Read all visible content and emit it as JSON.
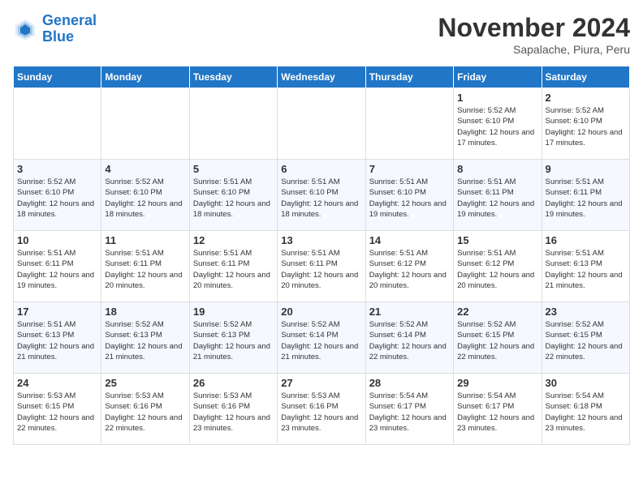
{
  "logo": {
    "line1": "General",
    "line2": "Blue"
  },
  "title": "November 2024",
  "subtitle": "Sapalache, Piura, Peru",
  "days_of_week": [
    "Sunday",
    "Monday",
    "Tuesday",
    "Wednesday",
    "Thursday",
    "Friday",
    "Saturday"
  ],
  "weeks": [
    [
      {
        "day": "",
        "info": ""
      },
      {
        "day": "",
        "info": ""
      },
      {
        "day": "",
        "info": ""
      },
      {
        "day": "",
        "info": ""
      },
      {
        "day": "",
        "info": ""
      },
      {
        "day": "1",
        "info": "Sunrise: 5:52 AM\nSunset: 6:10 PM\nDaylight: 12 hours and 17 minutes."
      },
      {
        "day": "2",
        "info": "Sunrise: 5:52 AM\nSunset: 6:10 PM\nDaylight: 12 hours and 17 minutes."
      }
    ],
    [
      {
        "day": "3",
        "info": "Sunrise: 5:52 AM\nSunset: 6:10 PM\nDaylight: 12 hours and 18 minutes."
      },
      {
        "day": "4",
        "info": "Sunrise: 5:52 AM\nSunset: 6:10 PM\nDaylight: 12 hours and 18 minutes."
      },
      {
        "day": "5",
        "info": "Sunrise: 5:51 AM\nSunset: 6:10 PM\nDaylight: 12 hours and 18 minutes."
      },
      {
        "day": "6",
        "info": "Sunrise: 5:51 AM\nSunset: 6:10 PM\nDaylight: 12 hours and 18 minutes."
      },
      {
        "day": "7",
        "info": "Sunrise: 5:51 AM\nSunset: 6:10 PM\nDaylight: 12 hours and 19 minutes."
      },
      {
        "day": "8",
        "info": "Sunrise: 5:51 AM\nSunset: 6:11 PM\nDaylight: 12 hours and 19 minutes."
      },
      {
        "day": "9",
        "info": "Sunrise: 5:51 AM\nSunset: 6:11 PM\nDaylight: 12 hours and 19 minutes."
      }
    ],
    [
      {
        "day": "10",
        "info": "Sunrise: 5:51 AM\nSunset: 6:11 PM\nDaylight: 12 hours and 19 minutes."
      },
      {
        "day": "11",
        "info": "Sunrise: 5:51 AM\nSunset: 6:11 PM\nDaylight: 12 hours and 20 minutes."
      },
      {
        "day": "12",
        "info": "Sunrise: 5:51 AM\nSunset: 6:11 PM\nDaylight: 12 hours and 20 minutes."
      },
      {
        "day": "13",
        "info": "Sunrise: 5:51 AM\nSunset: 6:11 PM\nDaylight: 12 hours and 20 minutes."
      },
      {
        "day": "14",
        "info": "Sunrise: 5:51 AM\nSunset: 6:12 PM\nDaylight: 12 hours and 20 minutes."
      },
      {
        "day": "15",
        "info": "Sunrise: 5:51 AM\nSunset: 6:12 PM\nDaylight: 12 hours and 20 minutes."
      },
      {
        "day": "16",
        "info": "Sunrise: 5:51 AM\nSunset: 6:13 PM\nDaylight: 12 hours and 21 minutes."
      }
    ],
    [
      {
        "day": "17",
        "info": "Sunrise: 5:51 AM\nSunset: 6:13 PM\nDaylight: 12 hours and 21 minutes."
      },
      {
        "day": "18",
        "info": "Sunrise: 5:52 AM\nSunset: 6:13 PM\nDaylight: 12 hours and 21 minutes."
      },
      {
        "day": "19",
        "info": "Sunrise: 5:52 AM\nSunset: 6:13 PM\nDaylight: 12 hours and 21 minutes."
      },
      {
        "day": "20",
        "info": "Sunrise: 5:52 AM\nSunset: 6:14 PM\nDaylight: 12 hours and 21 minutes."
      },
      {
        "day": "21",
        "info": "Sunrise: 5:52 AM\nSunset: 6:14 PM\nDaylight: 12 hours and 22 minutes."
      },
      {
        "day": "22",
        "info": "Sunrise: 5:52 AM\nSunset: 6:15 PM\nDaylight: 12 hours and 22 minutes."
      },
      {
        "day": "23",
        "info": "Sunrise: 5:52 AM\nSunset: 6:15 PM\nDaylight: 12 hours and 22 minutes."
      }
    ],
    [
      {
        "day": "24",
        "info": "Sunrise: 5:53 AM\nSunset: 6:15 PM\nDaylight: 12 hours and 22 minutes."
      },
      {
        "day": "25",
        "info": "Sunrise: 5:53 AM\nSunset: 6:16 PM\nDaylight: 12 hours and 22 minutes."
      },
      {
        "day": "26",
        "info": "Sunrise: 5:53 AM\nSunset: 6:16 PM\nDaylight: 12 hours and 23 minutes."
      },
      {
        "day": "27",
        "info": "Sunrise: 5:53 AM\nSunset: 6:16 PM\nDaylight: 12 hours and 23 minutes."
      },
      {
        "day": "28",
        "info": "Sunrise: 5:54 AM\nSunset: 6:17 PM\nDaylight: 12 hours and 23 minutes."
      },
      {
        "day": "29",
        "info": "Sunrise: 5:54 AM\nSunset: 6:17 PM\nDaylight: 12 hours and 23 minutes."
      },
      {
        "day": "30",
        "info": "Sunrise: 5:54 AM\nSunset: 6:18 PM\nDaylight: 12 hours and 23 minutes."
      }
    ]
  ]
}
